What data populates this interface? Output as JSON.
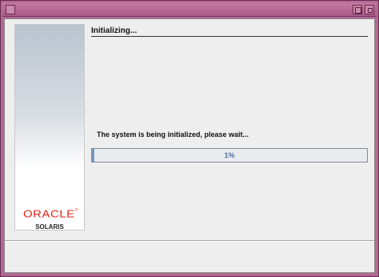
{
  "window": {
    "title": ""
  },
  "branding": {
    "logo_text": "ORACLE",
    "logo_mark": "®",
    "product": "SOLARIS"
  },
  "content": {
    "title": "Initializing...",
    "status": "The system is being initialized, please wait...",
    "progress_value": 0.01,
    "progress_label": "1%"
  },
  "colors": {
    "accent": "#e2231a",
    "progress": "#7a97c0",
    "frame": "#b06a92"
  }
}
